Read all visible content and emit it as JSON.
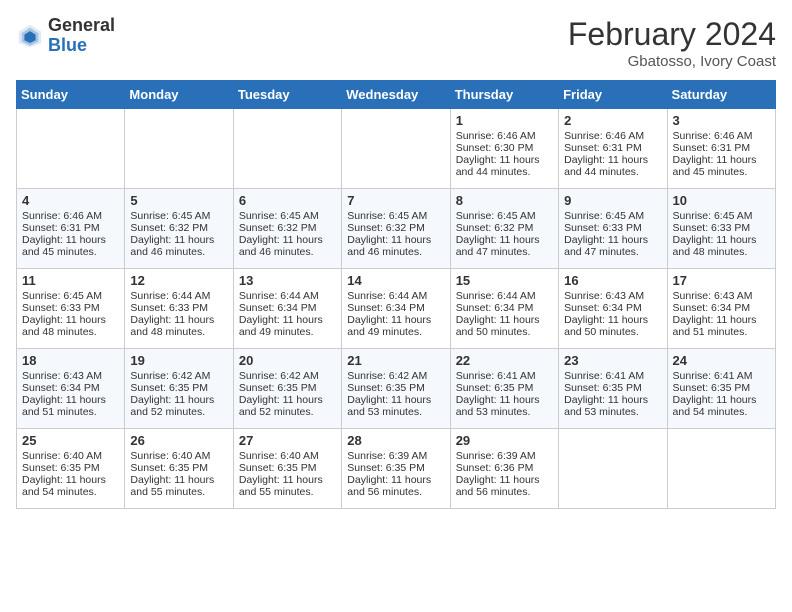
{
  "header": {
    "logo_general": "General",
    "logo_blue": "Blue",
    "month_year": "February 2024",
    "location": "Gbatosso, Ivory Coast"
  },
  "days_of_week": [
    "Sunday",
    "Monday",
    "Tuesday",
    "Wednesday",
    "Thursday",
    "Friday",
    "Saturday"
  ],
  "weeks": [
    [
      {
        "day": "",
        "data": ""
      },
      {
        "day": "",
        "data": ""
      },
      {
        "day": "",
        "data": ""
      },
      {
        "day": "",
        "data": ""
      },
      {
        "day": "1",
        "data": "Sunrise: 6:46 AM\nSunset: 6:30 PM\nDaylight: 11 hours and 44 minutes."
      },
      {
        "day": "2",
        "data": "Sunrise: 6:46 AM\nSunset: 6:31 PM\nDaylight: 11 hours and 44 minutes."
      },
      {
        "day": "3",
        "data": "Sunrise: 6:46 AM\nSunset: 6:31 PM\nDaylight: 11 hours and 45 minutes."
      }
    ],
    [
      {
        "day": "4",
        "data": "Sunrise: 6:46 AM\nSunset: 6:31 PM\nDaylight: 11 hours and 45 minutes."
      },
      {
        "day": "5",
        "data": "Sunrise: 6:45 AM\nSunset: 6:32 PM\nDaylight: 11 hours and 46 minutes."
      },
      {
        "day": "6",
        "data": "Sunrise: 6:45 AM\nSunset: 6:32 PM\nDaylight: 11 hours and 46 minutes."
      },
      {
        "day": "7",
        "data": "Sunrise: 6:45 AM\nSunset: 6:32 PM\nDaylight: 11 hours and 46 minutes."
      },
      {
        "day": "8",
        "data": "Sunrise: 6:45 AM\nSunset: 6:32 PM\nDaylight: 11 hours and 47 minutes."
      },
      {
        "day": "9",
        "data": "Sunrise: 6:45 AM\nSunset: 6:33 PM\nDaylight: 11 hours and 47 minutes."
      },
      {
        "day": "10",
        "data": "Sunrise: 6:45 AM\nSunset: 6:33 PM\nDaylight: 11 hours and 48 minutes."
      }
    ],
    [
      {
        "day": "11",
        "data": "Sunrise: 6:45 AM\nSunset: 6:33 PM\nDaylight: 11 hours and 48 minutes."
      },
      {
        "day": "12",
        "data": "Sunrise: 6:44 AM\nSunset: 6:33 PM\nDaylight: 11 hours and 48 minutes."
      },
      {
        "day": "13",
        "data": "Sunrise: 6:44 AM\nSunset: 6:34 PM\nDaylight: 11 hours and 49 minutes."
      },
      {
        "day": "14",
        "data": "Sunrise: 6:44 AM\nSunset: 6:34 PM\nDaylight: 11 hours and 49 minutes."
      },
      {
        "day": "15",
        "data": "Sunrise: 6:44 AM\nSunset: 6:34 PM\nDaylight: 11 hours and 50 minutes."
      },
      {
        "day": "16",
        "data": "Sunrise: 6:43 AM\nSunset: 6:34 PM\nDaylight: 11 hours and 50 minutes."
      },
      {
        "day": "17",
        "data": "Sunrise: 6:43 AM\nSunset: 6:34 PM\nDaylight: 11 hours and 51 minutes."
      }
    ],
    [
      {
        "day": "18",
        "data": "Sunrise: 6:43 AM\nSunset: 6:34 PM\nDaylight: 11 hours and 51 minutes."
      },
      {
        "day": "19",
        "data": "Sunrise: 6:42 AM\nSunset: 6:35 PM\nDaylight: 11 hours and 52 minutes."
      },
      {
        "day": "20",
        "data": "Sunrise: 6:42 AM\nSunset: 6:35 PM\nDaylight: 11 hours and 52 minutes."
      },
      {
        "day": "21",
        "data": "Sunrise: 6:42 AM\nSunset: 6:35 PM\nDaylight: 11 hours and 53 minutes."
      },
      {
        "day": "22",
        "data": "Sunrise: 6:41 AM\nSunset: 6:35 PM\nDaylight: 11 hours and 53 minutes."
      },
      {
        "day": "23",
        "data": "Sunrise: 6:41 AM\nSunset: 6:35 PM\nDaylight: 11 hours and 53 minutes."
      },
      {
        "day": "24",
        "data": "Sunrise: 6:41 AM\nSunset: 6:35 PM\nDaylight: 11 hours and 54 minutes."
      }
    ],
    [
      {
        "day": "25",
        "data": "Sunrise: 6:40 AM\nSunset: 6:35 PM\nDaylight: 11 hours and 54 minutes."
      },
      {
        "day": "26",
        "data": "Sunrise: 6:40 AM\nSunset: 6:35 PM\nDaylight: 11 hours and 55 minutes."
      },
      {
        "day": "27",
        "data": "Sunrise: 6:40 AM\nSunset: 6:35 PM\nDaylight: 11 hours and 55 minutes."
      },
      {
        "day": "28",
        "data": "Sunrise: 6:39 AM\nSunset: 6:35 PM\nDaylight: 11 hours and 56 minutes."
      },
      {
        "day": "29",
        "data": "Sunrise: 6:39 AM\nSunset: 6:36 PM\nDaylight: 11 hours and 56 minutes."
      },
      {
        "day": "",
        "data": ""
      },
      {
        "day": "",
        "data": ""
      }
    ]
  ]
}
